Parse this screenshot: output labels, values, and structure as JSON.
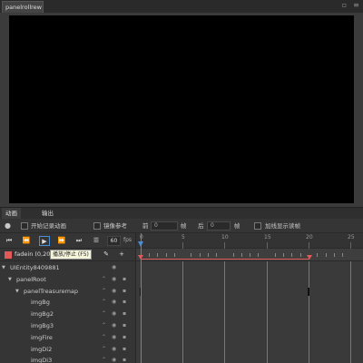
{
  "document": {
    "tab_title": "panelrollrew"
  },
  "panel": {
    "tabs": [
      {
        "label": "动画",
        "active": true
      },
      {
        "label": "输出",
        "active": false
      }
    ]
  },
  "options": {
    "record_label": "开始记录动画",
    "onion_label": "镜像参考",
    "prev_label": "前",
    "prev_value": "0",
    "frame_label1": "帧",
    "next_label": "后",
    "next_value": "0",
    "frame_label2": "帧",
    "hover_label": "加线显示读帧"
  },
  "controls": {
    "fps_value": "60",
    "fps_unit": "fps"
  },
  "clip": {
    "name": "fadein (0,20)",
    "tooltip": "播放/停止 (F5)",
    "color": "#e05a5a"
  },
  "timeline": {
    "tick_labels": [
      "0",
      "5",
      "10",
      "15",
      "20",
      "25"
    ],
    "playhead_frame": 0,
    "clip_end_frame": 20,
    "playhead_color": "#4a8fd6"
  },
  "tree": [
    {
      "label": "UIEntity8409881",
      "level": 0,
      "expanded": true
    },
    {
      "label": "panelRoot",
      "level": 1,
      "expanded": true
    },
    {
      "label": "panelTreasuremap",
      "level": 2,
      "expanded": true
    },
    {
      "label": "imgBg",
      "level": 3
    },
    {
      "label": "imgBg2",
      "level": 3
    },
    {
      "label": "imgBg3",
      "level": 3
    },
    {
      "label": "imgFire",
      "level": 3
    },
    {
      "label": "imgDi2",
      "level": 3
    },
    {
      "label": "imgDi3",
      "level": 3
    }
  ]
}
